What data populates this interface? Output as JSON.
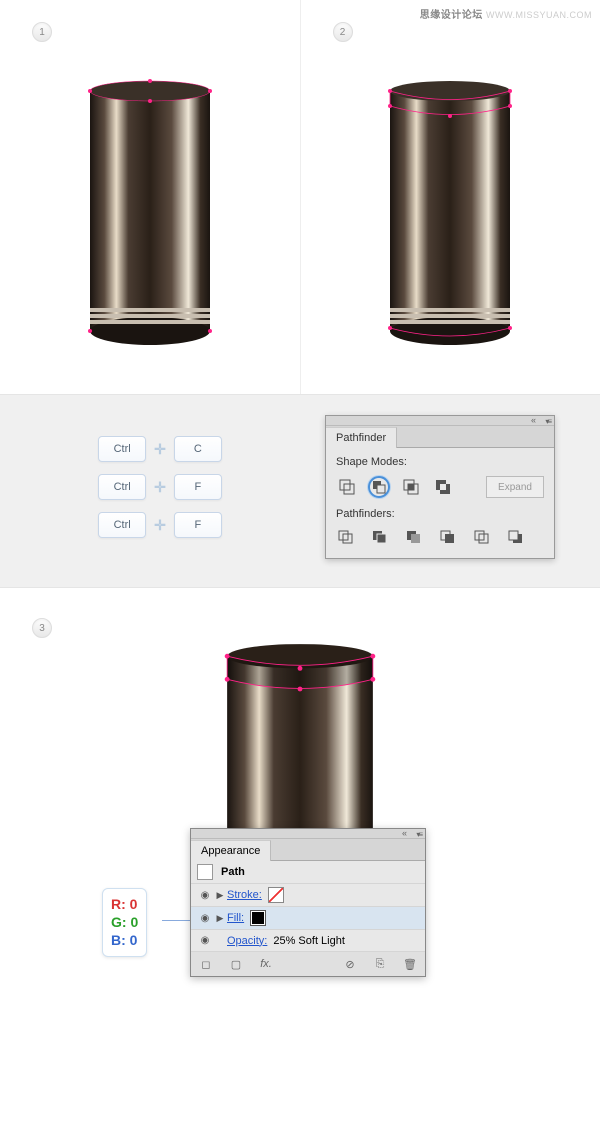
{
  "watermark": {
    "cn": "思缘设计论坛",
    "url": "WWW.MISSYUAN.COM"
  },
  "steps": {
    "s1": "1",
    "s2": "2",
    "s3": "3"
  },
  "shortcuts": {
    "ctrl": "Ctrl",
    "rows": [
      "C",
      "F",
      "F"
    ]
  },
  "pathfinder": {
    "title": "Pathfinder",
    "shape_modes": "Shape Modes:",
    "pathfinders": "Pathfinders:",
    "expand": "Expand"
  },
  "appearance": {
    "title": "Appearance",
    "path": "Path",
    "stroke": "Stroke:",
    "fill": "Fill:",
    "opacity": "Opacity:",
    "opacity_val": "25% Soft Light",
    "fx": "fx."
  },
  "rgb": {
    "r": "R: 0",
    "g": "G: 0",
    "b": "B: 0"
  }
}
